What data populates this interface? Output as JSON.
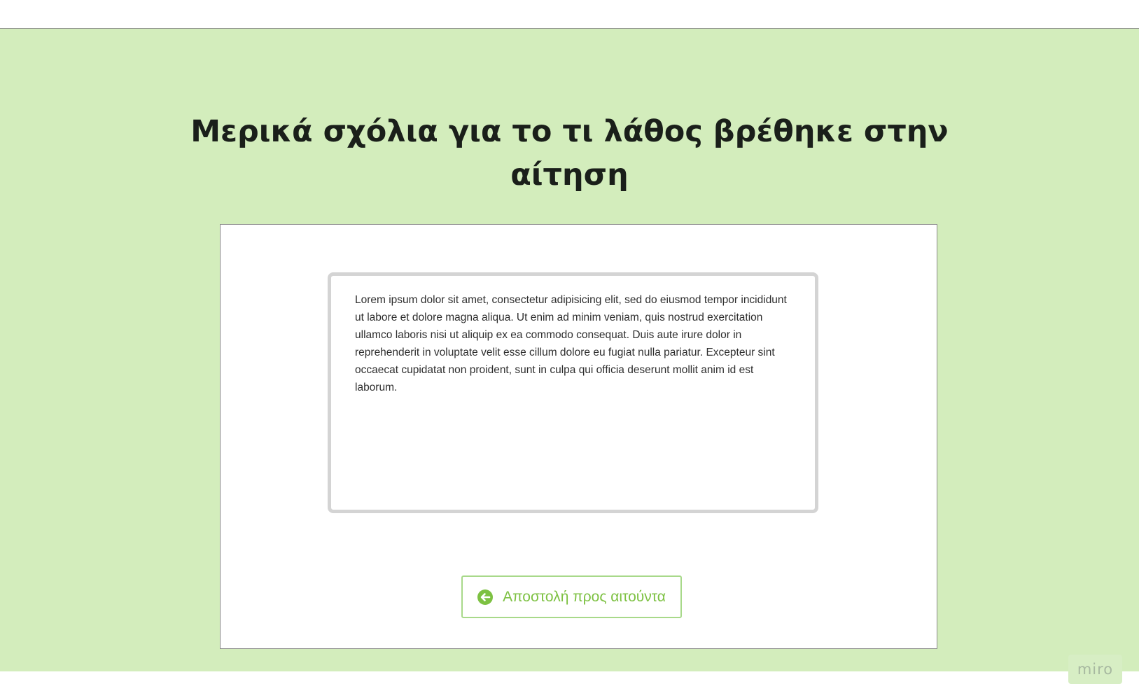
{
  "page": {
    "title_line1": "Μερικά σχόλια για το τι λάθος βρέθηκε στην",
    "title_line2": "αίτηση"
  },
  "comment": {
    "text": "Lorem ipsum dolor sit amet, consectetur adipisicing elit, sed do eiusmod tempor incididunt ut labore et dolore magna aliqua. Ut enim ad minim veniam, quis nostrud exercitation ullamco laboris nisi ut aliquip ex ea commodo consequat. Duis aute irure dolor in reprehenderit in voluptate velit esse cillum dolore eu fugiat nulla pariatur. Excepteur sint occaecat cupidatat non proident, sunt in culpa qui officia deserunt mollit anim id est laborum."
  },
  "send_button": {
    "label": "Αποστολή προς αιτούντα",
    "icon": "arrow-left-circle-icon"
  },
  "badge": {
    "label": "miro"
  },
  "colors": {
    "background": "#d3edbc",
    "accent": "#7dc142",
    "button_border": "#a8d98a",
    "title": "#1a1f1a"
  }
}
